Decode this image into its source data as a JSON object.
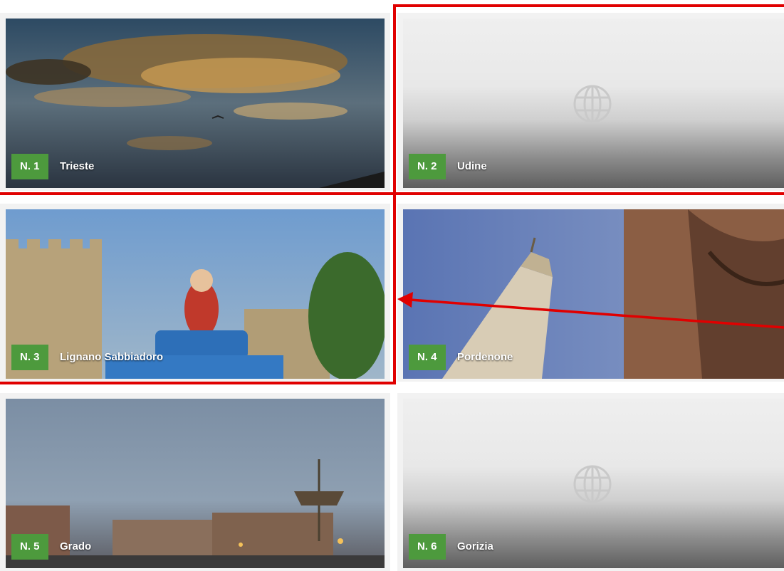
{
  "cities": [
    {
      "rank": "N. 1",
      "name": "Trieste"
    },
    {
      "rank": "N. 2",
      "name": "Udine"
    },
    {
      "rank": "N. 3",
      "name": "Lignano Sabbiadoro"
    },
    {
      "rank": "N. 4",
      "name": "Pordenone"
    },
    {
      "rank": "N. 5",
      "name": "Grado"
    },
    {
      "rank": "N. 6",
      "name": "Gorizia"
    }
  ],
  "colors": {
    "badge": "#4d9a3d",
    "highlight": "#e00000"
  },
  "icons": {
    "placeholder": "globe-icon",
    "annotation": "arrow-icon"
  }
}
